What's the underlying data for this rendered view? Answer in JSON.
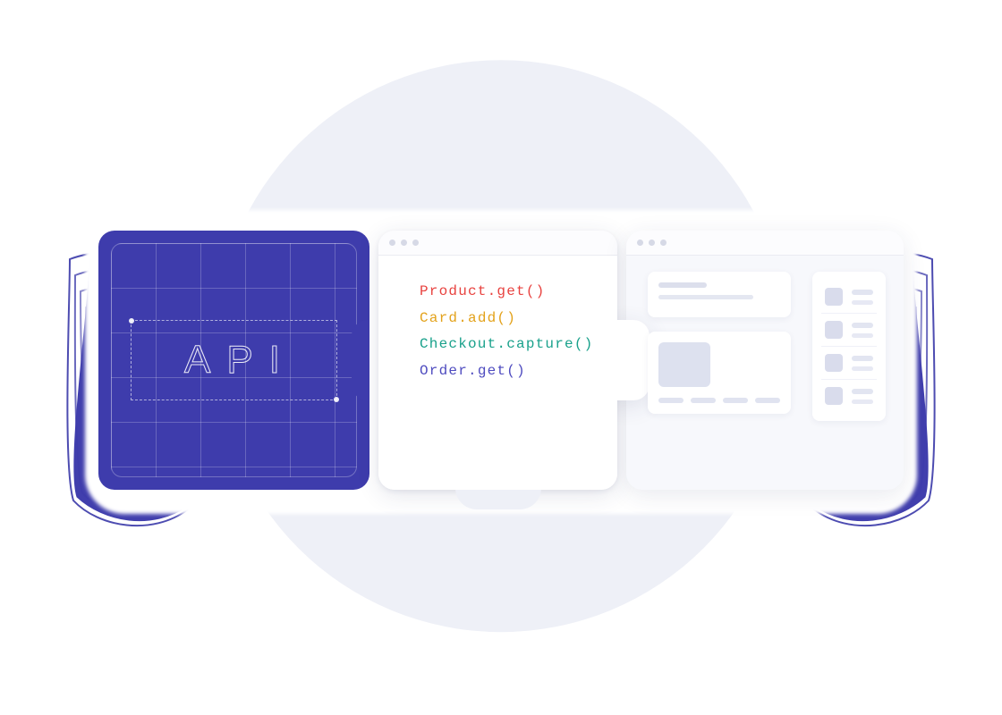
{
  "api_piece": {
    "label": "API"
  },
  "code_piece": {
    "lines": [
      {
        "object": "Product",
        "method": "get",
        "color": "c-red"
      },
      {
        "object": "Card",
        "method": "add",
        "color": "c-amber"
      },
      {
        "object": "Checkout",
        "method": "capture",
        "color": "c-green"
      },
      {
        "object": "Order",
        "method": "get",
        "color": "c-indigo"
      }
    ]
  }
}
